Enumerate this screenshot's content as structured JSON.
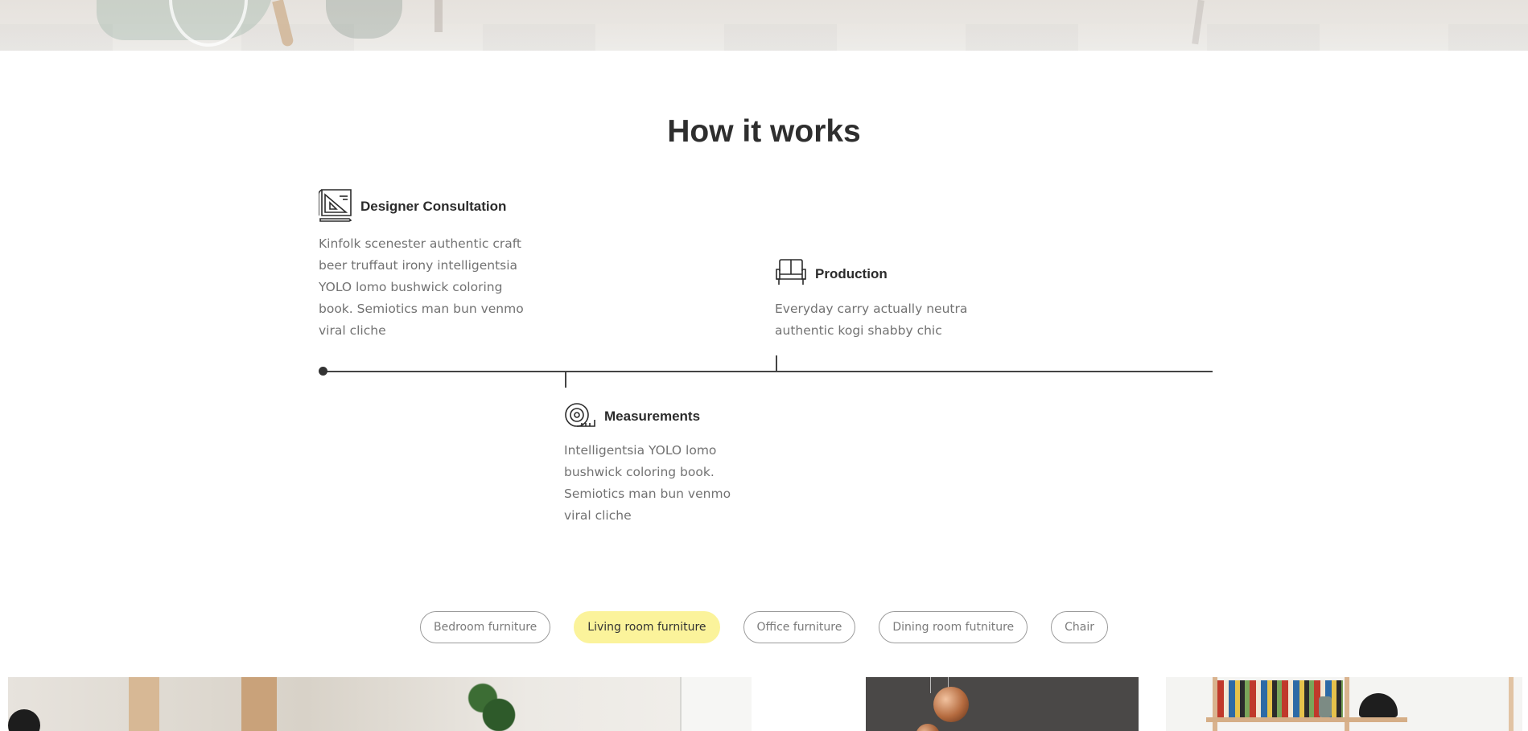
{
  "section": {
    "title": "How it works"
  },
  "steps": [
    {
      "title": "Designer Consultation",
      "icon": "blueprint-icon",
      "text": "Kinfolk scenester authentic craft beer truffaut irony intelligentsia YOLO lomo bushwick coloring book. Semiotics man bun venmo viral cliche"
    },
    {
      "title": "Measurements",
      "icon": "tape-measure-icon",
      "text": "Intelligentsia YOLO lomo bushwick coloring book. Semiotics man bun venmo viral cliche"
    },
    {
      "title": "Production",
      "icon": "sofa-icon",
      "text": "Everyday carry actually neutra authentic kogi shabby chic"
    }
  ],
  "filters": [
    {
      "label": "Bedroom furniture",
      "active": false
    },
    {
      "label": "Living room furniture",
      "active": true
    },
    {
      "label": "Office furniture",
      "active": false
    },
    {
      "label": "Dining room futniture",
      "active": false
    },
    {
      "label": "Chair",
      "active": false
    }
  ],
  "colors": {
    "accent": "#fbf39b",
    "heading": "#2e2e2e",
    "body_text": "#727272",
    "timeline": "#444444"
  }
}
